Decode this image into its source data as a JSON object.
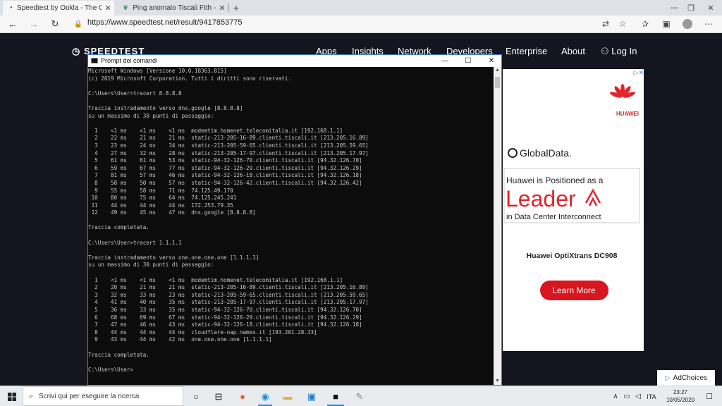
{
  "browser": {
    "tabs": [
      {
        "label": "Speedtest by Ookla - The Global Broadband Speed Test",
        "close": "✕",
        "active": true
      },
      {
        "label": "Ping anomalo Tiscali Ftth - Fibra",
        "close": "✕",
        "active": false
      }
    ],
    "new_tab": "+",
    "window_controls": {
      "minimize": "—",
      "restore": "❐",
      "close": "✕"
    },
    "url": "https://www.speedtest.net/result/9417853775"
  },
  "speedtest": {
    "logo": "SPEEDTEST",
    "nav": [
      "Apps",
      "Insights",
      "Network",
      "Developers",
      "Enterprise",
      "About"
    ],
    "login": "Log In",
    "ad": {
      "brand": "HUAWEI",
      "sponsor": "GlobalData.",
      "headline": "Huawei is Positioned as a",
      "big_word": "Leader",
      "sub": "in Data Center Interconnect",
      "product": "Huawei OptiXtrans DC908",
      "cta": "Learn More",
      "brand_color": "#e3242b",
      "cta_color": "#d8161f"
    },
    "ad_choices": "AdChoices"
  },
  "cmd": {
    "title": "Prompt dei comandi",
    "lines": [
      "Microsoft Windows [Versione 10.0.18363.815]",
      "(c) 2019 Microsoft Corporation. Tutti i diritti sono riservati.",
      "",
      "C:\\Users\\User>tracert 8.8.8.8",
      "",
      "Traccia instradamento verso dns.google [8.8.8.8]",
      "su un massimo di 30 punti di passaggio:",
      "",
      "  1    <1 ms    <1 ms    <1 ms  modemtim.homenet.telecomitalia.it [192.168.1.1]",
      "  2    22 ms    21 ms    21 ms  static-213-205-16-89.clienti.tiscali.it [213.205.16.89]",
      "  3    23 ms    24 ms    34 ms  static-213-205-59-65.clienti.tiscali.it [213.205.59.65]",
      "  4    27 ms    32 ms    28 ms  static-213-205-17-97.clienti.tiscali.it [213.205.17.97]",
      "  5    61 ms    61 ms    53 ms  static-94-32-126-70.clienti.tiscali.it [94.32.126.70]",
      "  6    59 ms    67 ms    77 ms  static-94-32-126-29.clienti.tiscali.it [94.32.126.29]",
      "  7    81 ms    57 ms    46 ms  static-94-32-126-18.clienti.tiscali.it [94.32.126.18]",
      "  8    58 ms    50 ms    57 ms  static-94-32-126-42.clienti.tiscali.it [94.32.126.42]",
      "  9    55 ms    58 ms    71 ms  74.125.49.170",
      " 10    80 ms    75 ms    64 ms  74.125.245.241",
      " 11    44 ms    44 ms    44 ms  172.253.79.35",
      " 12    49 ms    45 ms    47 ms  dns.google [8.8.8.8]",
      "",
      "Traccia completata.",
      "",
      "C:\\Users\\User>tracert 1.1.1.1",
      "",
      "Traccia instradamento verso one.one.one.one [1.1.1.1]",
      "su un massimo di 30 punti di passaggio:",
      "",
      "  1    <1 ms    <1 ms    <1 ms  modemtim.homenet.telecomitalia.it [192.168.1.1]",
      "  2    20 ms    21 ms    21 ms  static-213-205-16-89.clienti.tiscali.it [213.205.16.89]",
      "  3    32 ms    33 ms    23 ms  static-213-205-59-65.clienti.tiscali.it [213.205.59.65]",
      "  4    41 ms    40 ms    35 ms  static-213-205-17-97.clienti.tiscali.it [213.205.17.97]",
      "  5    36 ms    33 ms    35 ms  static-94-32-126-70.clienti.tiscali.it [94.32.126.70]",
      "  6    68 ms    69 ms    67 ms  static-94-32-126-29.clienti.tiscali.it [94.32.126.29]",
      "  7    47 ms    46 ms    43 ms  static-94-32-126-18.clienti.tiscali.it [94.32.126.18]",
      "  8    44 ms    44 ms    44 ms  cloudflare-nap.namex.it [193.201.28.33]",
      "  9    43 ms    44 ms    42 ms  one.one.one.one [1.1.1.1]",
      "",
      "Traccia completata.",
      "",
      "C:\\Users\\User>"
    ]
  },
  "taskbar": {
    "start_icon": "windows-logo-icon",
    "search_placeholder": "Scrivi qui per eseguire la ricerca",
    "time": "23:27",
    "date": "10/05/2020"
  }
}
